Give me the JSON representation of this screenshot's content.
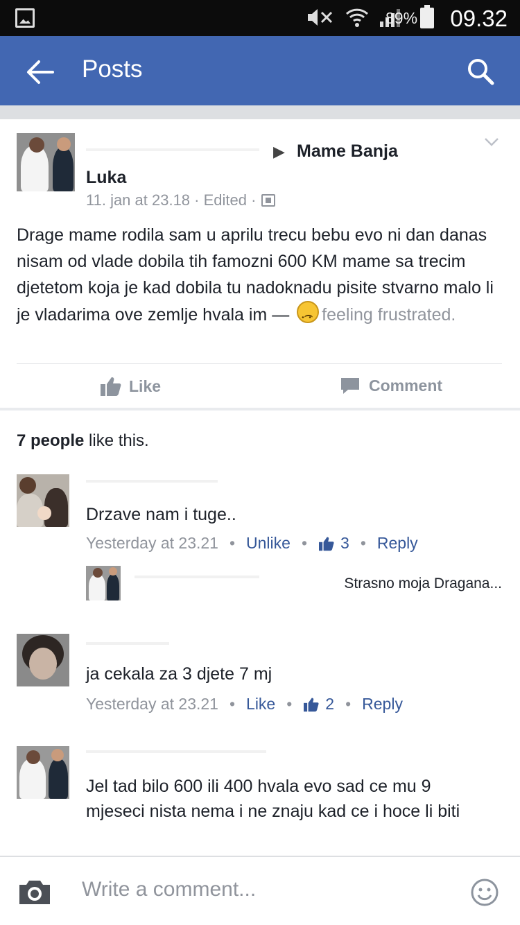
{
  "status_bar": {
    "battery": "89%",
    "time": "09.32"
  },
  "app_bar": {
    "title": "Posts"
  },
  "post": {
    "group": "Mame Banja",
    "author": "Luka",
    "meta": "11. jan at 23.18 · Edited ·",
    "text": "Drage mame rodila sam u aprilu trecu bebu evo ni dan danas nisam od vlade dobila tih famozni 600 KM mame sa trecim djetetom koja je kad dobila tu nadoknadu pisite stvarno malo li je vladarima ove zemlje hvala im —",
    "feeling": "feeling frustrated.",
    "like_label": "Like",
    "comment_label": "Comment"
  },
  "likes_summary": {
    "count_text": "7 people",
    "suffix": " like this."
  },
  "comments": [
    {
      "text": "Drzave nam i tuge..",
      "time": "Yesterday at 23.21",
      "action": "Unlike",
      "likes": "3",
      "reply": "Reply",
      "reply_preview": "Strasno moja Dragana..."
    },
    {
      "text": "ja cekala za 3 djete 7 mj",
      "time": "Yesterday at 23.21",
      "action": "Like",
      "likes": "2",
      "reply": "Reply"
    },
    {
      "text": "Jel tad bilo 600 ili 400 hvala evo sad ce mu 9 mjeseci nista nema i ne znaju kad ce i hoce li biti"
    }
  ],
  "composer": {
    "placeholder": "Write a comment..."
  },
  "colors": {
    "brand": "#4267b2",
    "link": "#365899",
    "meta": "#90949c"
  },
  "icons": [
    "gallery-icon",
    "mute-icon",
    "wifi-icon",
    "signal-icon",
    "battery-icon",
    "back-arrow-icon",
    "search-icon",
    "privacy-icon",
    "chevron-down-icon",
    "sad-face-icon",
    "thumbs-up-icon",
    "comment-icon",
    "camera-icon",
    "smile-icon"
  ]
}
